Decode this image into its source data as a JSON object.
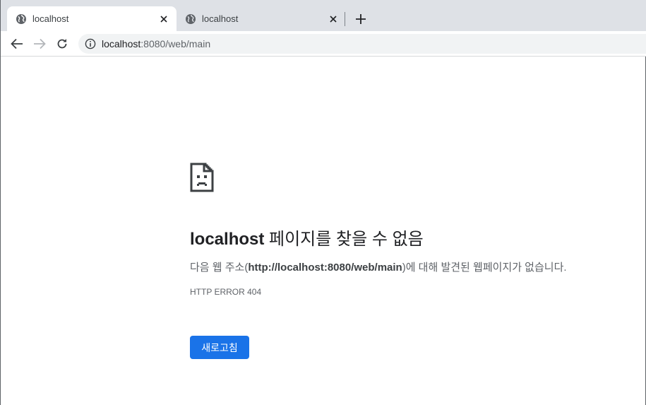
{
  "tabs": [
    {
      "title": "localhost",
      "active": true,
      "icon": "globe-icon"
    },
    {
      "title": "localhost",
      "active": false,
      "icon": "globe-icon"
    }
  ],
  "toolbar": {
    "url_host": "localhost",
    "url_rest": ":8080/web/main"
  },
  "error": {
    "host": "localhost",
    "title_rest": " 페이지를 찾을 수 없음",
    "desc_prefix": "다음 웹 주소(",
    "desc_url": "http://localhost:8080/web/main",
    "desc_suffix": ")에 대해 발견된 웹페이지가 없습니다.",
    "code": "HTTP ERROR 404",
    "reload_label": "새로고침"
  },
  "colors": {
    "accent": "#1a73e8",
    "tabstrip": "#dee1e6",
    "omnibox": "#f1f3f4"
  }
}
